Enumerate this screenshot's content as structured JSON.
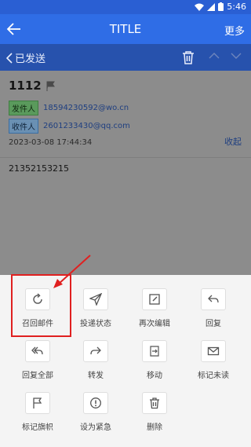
{
  "status_bar": {
    "time": "5:46"
  },
  "header": {
    "title": "TITLE",
    "more_label": "更多"
  },
  "subheader": {
    "back_label": "已发送"
  },
  "email": {
    "subject": "1112",
    "from_tag": "发件人",
    "from_address": "18594230592@wo.cn",
    "to_tag": "收件人",
    "to_address": "2601233430@qq.com",
    "datetime": "2023-03-08 17:44:34",
    "collapse_label": "收起",
    "body": "21352153215"
  },
  "actions": [
    {
      "label": "召回邮件",
      "icon": "recall-icon"
    },
    {
      "label": "投递状态",
      "icon": "send-status-icon"
    },
    {
      "label": "再次编辑",
      "icon": "edit-icon"
    },
    {
      "label": "回复",
      "icon": "reply-icon"
    },
    {
      "label": "回复全部",
      "icon": "reply-all-icon"
    },
    {
      "label": "转发",
      "icon": "forward-icon"
    },
    {
      "label": "移动",
      "icon": "move-icon"
    },
    {
      "label": "标记未读",
      "icon": "mark-unread-icon"
    },
    {
      "label": "标记旗帜",
      "icon": "flag-icon"
    },
    {
      "label": "设为紧急",
      "icon": "urgent-icon"
    },
    {
      "label": "删除",
      "icon": "delete-icon"
    }
  ],
  "colors": {
    "status_bar": "#2a5fd3",
    "title_bar": "#2f6de6",
    "highlight": "#e02020",
    "sheet_bg": "#f4f4f4"
  }
}
